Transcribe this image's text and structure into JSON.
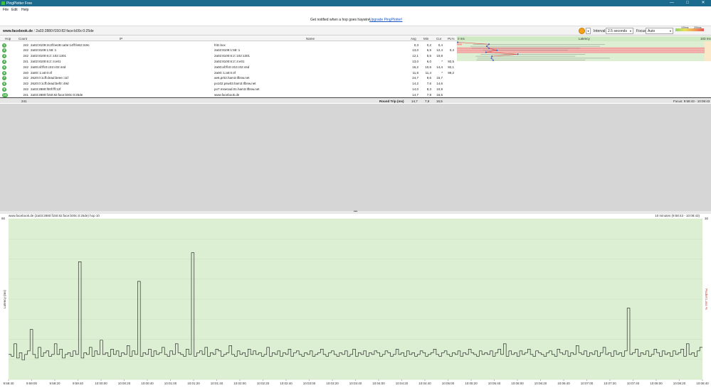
{
  "window": {
    "title": "PingPlotter Free",
    "min_glyph": "—",
    "max_glyph": "□",
    "close_glyph": "✕"
  },
  "menu": {
    "file": "File",
    "edit": "Edit",
    "help": "Help"
  },
  "banner": {
    "message": "Get notified when a hop goes haywire.",
    "link": "Upgrade PingPlotter!"
  },
  "targetbar": {
    "host": "www.facebook.de",
    "separator": "/",
    "ip": "2a03:2880:f150:82:face:b00c:0:25de",
    "interval_label": "Interval:",
    "interval_value": "2.5 seconds",
    "focus_label": "Focus:",
    "focus_value": "Auto",
    "legend_100": "100ms",
    "legend_200": "200ms",
    "dropdown_glyph": "▾"
  },
  "columns": {
    "hop": "Hop",
    "count": "Count",
    "ip": "IP",
    "name": "Name",
    "avg": "Avg",
    "min": "Min",
    "cur": "Cur",
    "pl": "PL%",
    "zero_ms": "0 ms",
    "latency": "Latency",
    "max_ms": "103 ms"
  },
  "hops": [
    {
      "hop": "1",
      "count": "242",
      "ip": "2a02:8109:2c3f:be28:ca0e:14ff:fe82:3c9c",
      "name": "fritz.box",
      "avg": "0,3",
      "min": "0,2",
      "cur": "0,4",
      "pl": "",
      "avg_ms": 0.3,
      "min_ms": 0.2,
      "max_ms": 1.0,
      "loss": 0
    },
    {
      "hop": "2",
      "count": "242",
      "ip": "2a02:8109:1:58::1",
      "name": "2a02:8109:1:58::1",
      "avg": "13,0",
      "min": "6,5",
      "cur": "12,4",
      "pl": "0,4",
      "avg_ms": 13.0,
      "min_ms": 6.5,
      "max_ms": 60,
      "loss": 0.4
    },
    {
      "hop": "3",
      "count": "242",
      "ip": "2a02:8100:6:2::102:1301",
      "name": "2a02:8100:6:2::102:1301",
      "avg": "12,1",
      "min": "5,5",
      "cur": "10,8",
      "pl": "",
      "avg_ms": 12.1,
      "min_ms": 5.5,
      "max_ms": 58,
      "loss": 0
    },
    {
      "hop": "4",
      "count": "241",
      "ip": "2a02:8100:6:2::4:e01",
      "name": "2a02:8100:6:2::4:e01",
      "avg": "13,0",
      "min": "6,0",
      "cur": "*",
      "pl": "92,5",
      "avg_ms": 13.0,
      "min_ms": 6.0,
      "max_ms": 50,
      "loss": 92.5
    },
    {
      "hop": "5",
      "count": "242",
      "ip": "2a00:af:ffc0:c02:c02:44d",
      "name": "2a00:af:ffc0:c02:c02:44d",
      "avg": "16,2",
      "min": "10,6",
      "cur": "14,4",
      "pl": "92,1",
      "avg_ms": 16.2,
      "min_ms": 10.6,
      "max_ms": 45,
      "loss": 92.1
    },
    {
      "hop": "6",
      "count": "240",
      "ip": "2a00::1:a0:0:4f",
      "name": "2a00::1:a0:0:4f",
      "avg": "11,8",
      "min": "11,4",
      "cur": "*",
      "pl": "99,2",
      "avg_ms": 11.8,
      "min_ms": 11.4,
      "max_ms": 14,
      "loss": 99.2
    },
    {
      "hop": "7",
      "count": "242",
      "ip": "2620:0:1cff:dead:beee::11f",
      "name": "ae6.pr02.ham3.tfbnw.net",
      "avg": "24,7",
      "min": "9,6",
      "cur": "15,7",
      "pl": "",
      "avg_ms": 24.7,
      "min_ms": 9.6,
      "max_ms": 52,
      "loss": 0
    },
    {
      "hop": "8",
      "count": "242",
      "ip": "2620:0:1cff:dead:bef0::49d",
      "name": "po102.psw03.ham3.tfbnw.net",
      "avg": "14,2",
      "min": "7,6",
      "cur": "14,6",
      "pl": "",
      "avg_ms": 14.2,
      "min_ms": 7.6,
      "max_ms": 48,
      "loss": 0
    },
    {
      "hop": "9",
      "count": "242",
      "ip": "2a03:2880:f00f:fff:12f",
      "name": "po7.msw1ad.01.ham3.tfbnw.net",
      "avg": "14,0",
      "min": "8,3",
      "cur": "10,9",
      "pl": "",
      "avg_ms": 14.0,
      "min_ms": 8.3,
      "max_ms": 62,
      "loss": 0
    },
    {
      "hop": "10",
      "count": "241",
      "ip": "2a03:2880:f150:82:face:b00c:0:25de",
      "name": "www.facebook.de",
      "avg": "14,7",
      "min": "7,9",
      "cur": "16,5",
      "pl": "",
      "avg_ms": 14.7,
      "min_ms": 7.9,
      "max_ms": 52,
      "loss": 0
    }
  ],
  "summary": {
    "count": "241",
    "label": "Round Trip (ms)",
    "avg": "14,7",
    "min": "7,9",
    "cur": "16,5",
    "focus": "Focus: 9:58:43 - 10:08:43"
  },
  "splitter": {
    "handle": "•••"
  },
  "timeline": {
    "title": "www.facebook.de (2a03:2880:f150:82:face:b00c:0:25de) hop 10",
    "range": "10 minutes (9:58:43 - 10:08:43)",
    "y_left_label": "Latency (ms)",
    "y_right_label": "Packet Loss %",
    "y_top_left": "90",
    "y_top_right": "30"
  },
  "chart_data": {
    "type": "line",
    "title": "www.facebook.de (2a03:2880:f150:82:face:b00c:0:25de) hop 10",
    "xlabel": "",
    "ylabel": "Latency (ms)",
    "ylim": [
      0,
      90
    ],
    "x_ticks": [
      "9:58:40",
      "9:59:00",
      "9:59:20",
      "9:59:40",
      "10:00:00",
      "10:00:20",
      "10:00:40",
      "10:01:00",
      "10:01:20",
      "10:01:40",
      "10:02:00",
      "10:02:20",
      "10:02:40",
      "10:03:00",
      "10:03:20",
      "10:03:40",
      "10:04:00",
      "10:04:20",
      "10:04:40",
      "10:05:00",
      "10:05:20",
      "10:05:40",
      "10:06:00",
      "10:06:20",
      "10:06:40",
      "10:07:00",
      "10:07:20",
      "10:07:40",
      "10:08:00",
      "10:08:20",
      "10:08:40"
    ],
    "series": [
      {
        "values": [
          14,
          13,
          20,
          12,
          15,
          11,
          14,
          16,
          28,
          14,
          12,
          18,
          13,
          15,
          16,
          13,
          14,
          20,
          14,
          17,
          12,
          14,
          15,
          13,
          16,
          14,
          66,
          12,
          15,
          14,
          18,
          13,
          16,
          14,
          22,
          14,
          15,
          13,
          17,
          14,
          16,
          13,
          15,
          14,
          19,
          13,
          16,
          14,
          55,
          13,
          15,
          14,
          17,
          13,
          16,
          14,
          15,
          18,
          14,
          13,
          16,
          14,
          20,
          15,
          14,
          13,
          17,
          14,
          71,
          13,
          15,
          16,
          14,
          18,
          13,
          15,
          14,
          17,
          16,
          13,
          14,
          15,
          19,
          14,
          13,
          16,
          14,
          15,
          13,
          17,
          14,
          16,
          14,
          15,
          13,
          14,
          18,
          13,
          15,
          14,
          16,
          13,
          15,
          14,
          17,
          13,
          15,
          16,
          14,
          13,
          15,
          14,
          16,
          13,
          14,
          15,
          17,
          14,
          13,
          15,
          16,
          14,
          13,
          15,
          14,
          16,
          13,
          14,
          17,
          13,
          15,
          14,
          16,
          13,
          15,
          14,
          16,
          15,
          13,
          14,
          16,
          15,
          13,
          14,
          17,
          14,
          15,
          13,
          16,
          14,
          15,
          13,
          14,
          16,
          15,
          13,
          14,
          15,
          17,
          14,
          13,
          15,
          16,
          14,
          13,
          15,
          14,
          16,
          13,
          15,
          14,
          17,
          15,
          14,
          13,
          16,
          14,
          15,
          14,
          16,
          13,
          15,
          17,
          14,
          20,
          13,
          16,
          14,
          15,
          13,
          16,
          14,
          15,
          17,
          14,
          13,
          16,
          15,
          14,
          13,
          15,
          16,
          14,
          13,
          17,
          15,
          14,
          16,
          13,
          15,
          14,
          19,
          15,
          14,
          16,
          13,
          15,
          14,
          16,
          13,
          15,
          18,
          14,
          15,
          13,
          16,
          14,
          15,
          13,
          16,
          40,
          14,
          15,
          17,
          13,
          15,
          14,
          16,
          13,
          14,
          17,
          15,
          13,
          16,
          14,
          15,
          13,
          16,
          14,
          15,
          17,
          13,
          20,
          14,
          15,
          13,
          16,
          18
        ]
      }
    ]
  },
  "colors": {
    "titlebar": "#1b6b8f",
    "chart_bg": "#dcefd3",
    "loss": "#f4a3a3",
    "line": "#e23b3b",
    "hop_badge": "#4caf50"
  }
}
